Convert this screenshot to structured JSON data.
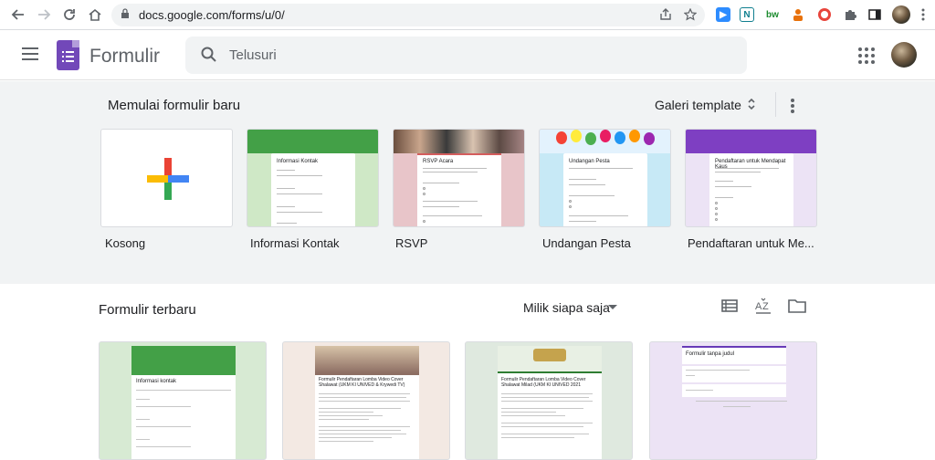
{
  "browser": {
    "url": "docs.google.com/forms/u/0/"
  },
  "app": {
    "title": "Formulir",
    "search_placeholder": "Telusuri"
  },
  "gallery": {
    "title": "Memulai formulir baru",
    "template_gallery_label": "Galeri template",
    "templates": [
      {
        "label": "Kosong"
      },
      {
        "label": "Informasi Kontak",
        "card_title": "Informasi Kontak",
        "accent": "#43a047",
        "bg": "#cfe8c6"
      },
      {
        "label": "RSVP",
        "card_title": "RSVP Acara",
        "accent": "#d45d5d",
        "bg": "#e8c5c9"
      },
      {
        "label": "Undangan Pesta",
        "card_title": "Undangan Pesta",
        "accent": "#4fc3f7",
        "bg": "#c7e9f6"
      },
      {
        "label": "Pendaftaran untuk Me...",
        "card_title": "Pendaftaran untuk Mendapat Kaus",
        "accent": "#7e3fc2",
        "bg": "#ece3f5"
      }
    ]
  },
  "recent": {
    "title": "Formulir terbaru",
    "owner_filter": "Milik siapa saja",
    "items": [
      {
        "title": "Informasi kontak",
        "bg": "#d7ead3",
        "accent": "#43a047"
      },
      {
        "title": "Formulir Pendaftaran Lomba Video Cover Shalawat (UKM KI UNIVED & Krywedi TV)",
        "bg": "#f3e9e3",
        "accent": "#8d6e63"
      },
      {
        "title": "Formulir Pendaftaran Lomba Video Cover Shalawat Milad (UKM KI UNIVED 2021",
        "bg": "#dfe9df",
        "accent": "#2e7d32"
      },
      {
        "title": "Formulir tanpa judul",
        "bg": "#ece3f5",
        "accent": "#673ab7"
      }
    ]
  },
  "icons": [
    "back-icon",
    "forward-icon",
    "reload-icon",
    "home-icon",
    "lock-icon",
    "share-icon",
    "star-icon",
    "extensions-icon",
    "menu-icon",
    "search-icon",
    "apps-icon",
    "unfold-icon",
    "more-vert-icon",
    "list-view-icon",
    "sort-az-icon",
    "folder-icon"
  ]
}
